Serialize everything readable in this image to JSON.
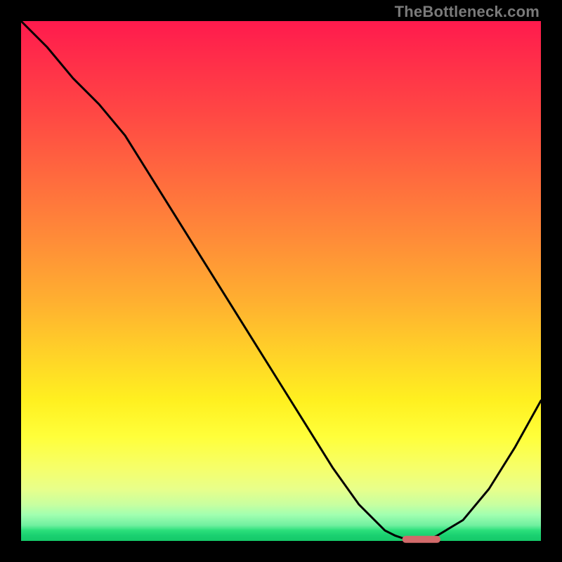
{
  "watermark": "TheBottleneck.com",
  "chart_data": {
    "type": "line",
    "title": "",
    "xlabel": "",
    "ylabel": "",
    "xlim": [
      0,
      100
    ],
    "ylim": [
      0,
      100
    ],
    "grid": false,
    "legend": false,
    "x": [
      0,
      5,
      10,
      15,
      20,
      25,
      30,
      35,
      40,
      45,
      50,
      55,
      60,
      65,
      70,
      72,
      75,
      78,
      80,
      85,
      90,
      95,
      100
    ],
    "values": [
      100,
      95,
      89,
      84,
      78,
      70,
      62,
      54,
      46,
      38,
      30,
      22,
      14,
      7,
      2,
      1,
      0,
      0,
      1,
      4,
      10,
      18,
      27
    ],
    "marker_segment": {
      "x0": 74,
      "x1": 80,
      "y": 0.3
    },
    "background": "red-yellow-green vertical gradient"
  }
}
